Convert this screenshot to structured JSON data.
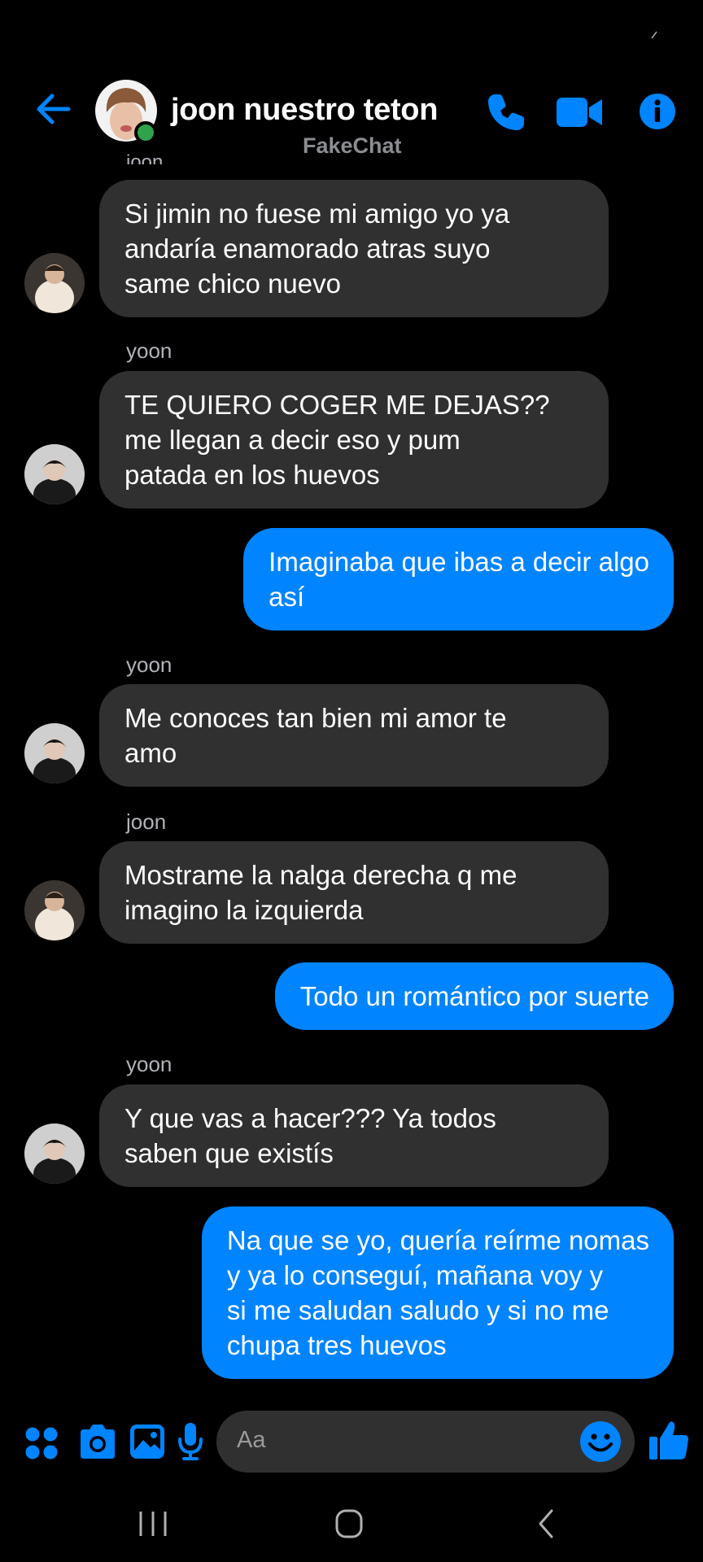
{
  "header": {
    "contact_name": "joon nuestro teton",
    "watermark": "FakeChat",
    "cut_sender": "joon"
  },
  "messages": [
    {
      "side": "in",
      "sender": "",
      "avatar": "joon",
      "text": "Si jimin no fuese mi amigo yo ya\nandaría enamorado atras suyo\nsame chico nuevo"
    },
    {
      "side": "in",
      "sender": "yoon",
      "avatar": "yoon",
      "text": "TE QUIERO COGER ME DEJAS??\nme llegan a decir eso y pum\npatada en los huevos"
    },
    {
      "side": "out",
      "text": "Imaginaba que ibas a decir algo\nasí"
    },
    {
      "side": "in",
      "sender": "yoon",
      "avatar": "yoon",
      "text": "Me conoces tan bien mi amor te\namo"
    },
    {
      "side": "in",
      "sender": "joon",
      "avatar": "joon",
      "text": "Mostrame la nalga derecha q me\nimagino la izquierda"
    },
    {
      "side": "out",
      "text": "Todo un romántico por suerte"
    },
    {
      "side": "in",
      "sender": "yoon",
      "avatar": "yoon",
      "text": "Y que vas a hacer??? Ya todos\nsaben que existís"
    },
    {
      "side": "out",
      "text": "Na que se yo, quería reírme nomas\ny ya lo conseguí, mañana voy y\nsi me saludan saludo y si no me\nchupa tres huevos"
    }
  ],
  "composer": {
    "placeholder": "Aa"
  },
  "icons": {
    "back": "back-arrow-icon",
    "call": "phone-icon",
    "video": "video-camera-icon",
    "info": "info-icon",
    "menu": "four-dots-icon",
    "camera": "camera-icon",
    "gallery": "image-icon",
    "mic": "microphone-icon",
    "emoji": "smiley-icon",
    "like": "thumbs-up-icon",
    "recents": "recents-icon",
    "home": "home-icon",
    "nav_back": "nav-back-icon"
  },
  "colors": {
    "accent": "#0084ff",
    "incoming_bubble": "#303030",
    "online": "#31a24c",
    "background": "#000000"
  }
}
